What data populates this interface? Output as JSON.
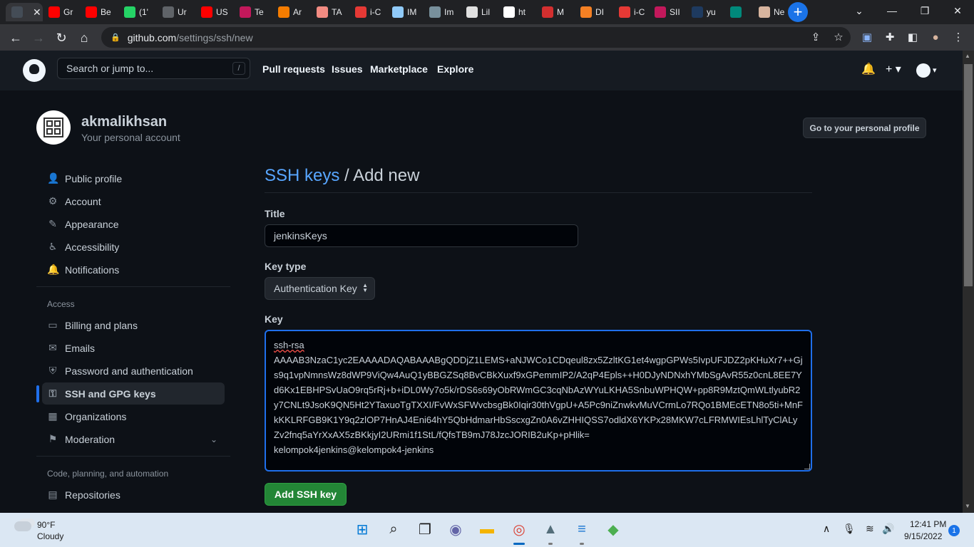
{
  "browser": {
    "tabs": [
      {
        "label": "",
        "fav": "github",
        "color": "#444c56"
      },
      {
        "label": "Gr",
        "fav": "youtube",
        "color": "#ff0000"
      },
      {
        "label": "Be",
        "fav": "youtube",
        "color": "#ff0000"
      },
      {
        "label": "(1'",
        "fav": "whatsapp",
        "color": "#25d366"
      },
      {
        "label": "Ur",
        "fav": "globe",
        "color": "#5f6368"
      },
      {
        "label": "US",
        "fav": "youtube",
        "color": "#ff0000"
      },
      {
        "label": "Te",
        "fav": "ink",
        "color": "#c2185b"
      },
      {
        "label": "Ar",
        "fav": "aws",
        "color": "#f57c00"
      },
      {
        "label": "TA",
        "fav": "ta",
        "color": "#f28b82"
      },
      {
        "label": "i-C",
        "fav": "gitlab",
        "color": "#e53935"
      },
      {
        "label": "IM",
        "fav": "im",
        "color": "#90caf9"
      },
      {
        "label": "Im",
        "fav": "gear",
        "color": "#78909c"
      },
      {
        "label": "Lil",
        "fav": "doc",
        "color": "#e0e0e0"
      },
      {
        "label": "ht",
        "fav": "google",
        "color": "#ffffff"
      },
      {
        "label": "M",
        "fav": "oo",
        "color": "#d32f2f"
      },
      {
        "label": "DI",
        "fav": "cloud",
        "color": "#f48024"
      },
      {
        "label": "i-C",
        "fav": "gitlab",
        "color": "#e53935"
      },
      {
        "label": "SII",
        "fav": "ink",
        "color": "#c2185b"
      },
      {
        "label": "yu",
        "fav": "circle",
        "color": "#1e3a5f"
      },
      {
        "label": "",
        "fav": "meet",
        "color": "#00897b"
      },
      {
        "label": "Ne",
        "fav": "jenkins",
        "color": "#d7b49e"
      }
    ],
    "close_glyph": "✕",
    "new_tab": "+",
    "window_controls": {
      "down": "⌄",
      "minimize": "—",
      "restore": "❐",
      "close": "✕"
    },
    "nav": {
      "back": "←",
      "forward": "→",
      "reload": "↻",
      "home": "⌂"
    },
    "url_host": "github.com",
    "url_path": "/settings/ssh/new",
    "lock": "🔒",
    "toolbar_icons": {
      "share": "⇪",
      "star": "☆",
      "ext1": "▣",
      "puzzle": "✚",
      "sidepanel": "◧",
      "profile": "●",
      "menu": "⋮"
    }
  },
  "github": {
    "search_placeholder": "Search or jump to...",
    "search_key": "/",
    "nav": [
      "Pull requests",
      "Issues",
      "Marketplace",
      "Explore"
    ],
    "bell": "🔔",
    "plus": "+ ▾",
    "avatar_caret": "▾"
  },
  "profile": {
    "username": "akmalikhsan",
    "subtitle": "Your personal account",
    "go_profile": "Go to your personal profile"
  },
  "sidebar": {
    "top": [
      {
        "label": "Public profile",
        "icon": "person-icon",
        "glyph": "👤"
      },
      {
        "label": "Account",
        "icon": "gear-icon",
        "glyph": "⚙"
      },
      {
        "label": "Appearance",
        "icon": "paintbrush-icon",
        "glyph": "✎"
      },
      {
        "label": "Accessibility",
        "icon": "accessibility-icon",
        "glyph": "♿"
      },
      {
        "label": "Notifications",
        "icon": "bell-icon",
        "glyph": "🔔"
      }
    ],
    "access_heading": "Access",
    "access": [
      {
        "label": "Billing and plans",
        "icon": "credit-card-icon",
        "glyph": "▭"
      },
      {
        "label": "Emails",
        "icon": "mail-icon",
        "glyph": "✉"
      },
      {
        "label": "Password and authentication",
        "icon": "shield-icon",
        "glyph": "⛨"
      },
      {
        "label": "SSH and GPG keys",
        "icon": "key-icon",
        "glyph": "⚿"
      },
      {
        "label": "Organizations",
        "icon": "organization-icon",
        "glyph": "▦"
      },
      {
        "label": "Moderation",
        "icon": "report-icon",
        "glyph": "⚑"
      }
    ],
    "code_heading": "Code, planning, and automation",
    "code": [
      {
        "label": "Repositories",
        "icon": "repo-icon",
        "glyph": "▤"
      }
    ]
  },
  "form": {
    "crumb": "SSH keys",
    "separator": " / ",
    "page_title": "Add new",
    "title_label": "Title",
    "title_value": "jenkinsKeys",
    "keytype_label": "Key type",
    "keytype_value": "Authentication Key",
    "key_label": "Key",
    "key_prefix": "ssh-rsa",
    "key_body": "AAAAB3NzaC1yc2EAAAADAQABAAABgQDDjZ1LEMS+aNJWCo1CDqeul8zx5ZzltKG1et4wgpGPWs5IvpUFJDZ2pKHuXr7++Gjs9q1vpNmnsWz8dWP9ViQw4AuQ1yBBGZSq8BvCBkXuxf9xGPemmIP2/A2qP4Epls++H0DJyNDNxhYMbSgAvR55z0cnL8EE7Yd6Kx1EBHPSvUaO9rq5rRj+b+iDL0Wy7o5k/rDS6s69yObRWmGC3cqNbAzWYuLKHA5SnbuWPHQW+pp8R9MztQmWLtlyubR2y7CNLt9JsoK9QN5Ht2YTaxuoTgTXXI/FvWxSFWvcbsgBk0Iqir30thVgpU+A5Pc9niZnwkvMuVCrmLo7RQo1BMEcETN8o5ti+MnFkKKLRFGB9K1Y9q2zlOP7HnAJ4Eni64hY5QbHdmarHbSscxgZn0A6vZHHIQSS7odldX6YKPx28MKW7cLFRMWIEsLhlTyClALyZv2fnq5aYrXxAX5zBKkjyI2URmi1f1StL/fQfsTB9mJ78JzcJORIB2uKp+pHlik=",
    "key_comment": "kelompok4jenkins@kelompok4-jenkins",
    "submit": "Add SSH key"
  },
  "taskbar": {
    "temp": "90°F",
    "condition": "Cloudy",
    "time": "12:41 PM",
    "date": "9/15/2022",
    "notifications": "1",
    "apps": [
      {
        "name": "start-button",
        "glyph": "⊞",
        "color": "#0078d4"
      },
      {
        "name": "search-button",
        "glyph": "⌕",
        "color": "#1b1b1b"
      },
      {
        "name": "task-view-button",
        "glyph": "❐",
        "color": "#1b1b1b"
      },
      {
        "name": "chat-app",
        "glyph": "◉",
        "color": "#6264a7"
      },
      {
        "name": "file-explorer-app",
        "glyph": "▬",
        "color": "#f4b400"
      },
      {
        "name": "chrome-app",
        "glyph": "◎",
        "color": "#db4437"
      },
      {
        "name": "monitor-app",
        "glyph": "▲",
        "color": "#546e7a"
      },
      {
        "name": "notepad-app",
        "glyph": "≡",
        "color": "#1976d2"
      },
      {
        "name": "git-app",
        "glyph": "◆",
        "color": "#4caf50"
      }
    ],
    "tray": {
      "chevron": "∧",
      "mic": "🎙",
      "wifi": "≋",
      "volume": "🔊"
    }
  }
}
